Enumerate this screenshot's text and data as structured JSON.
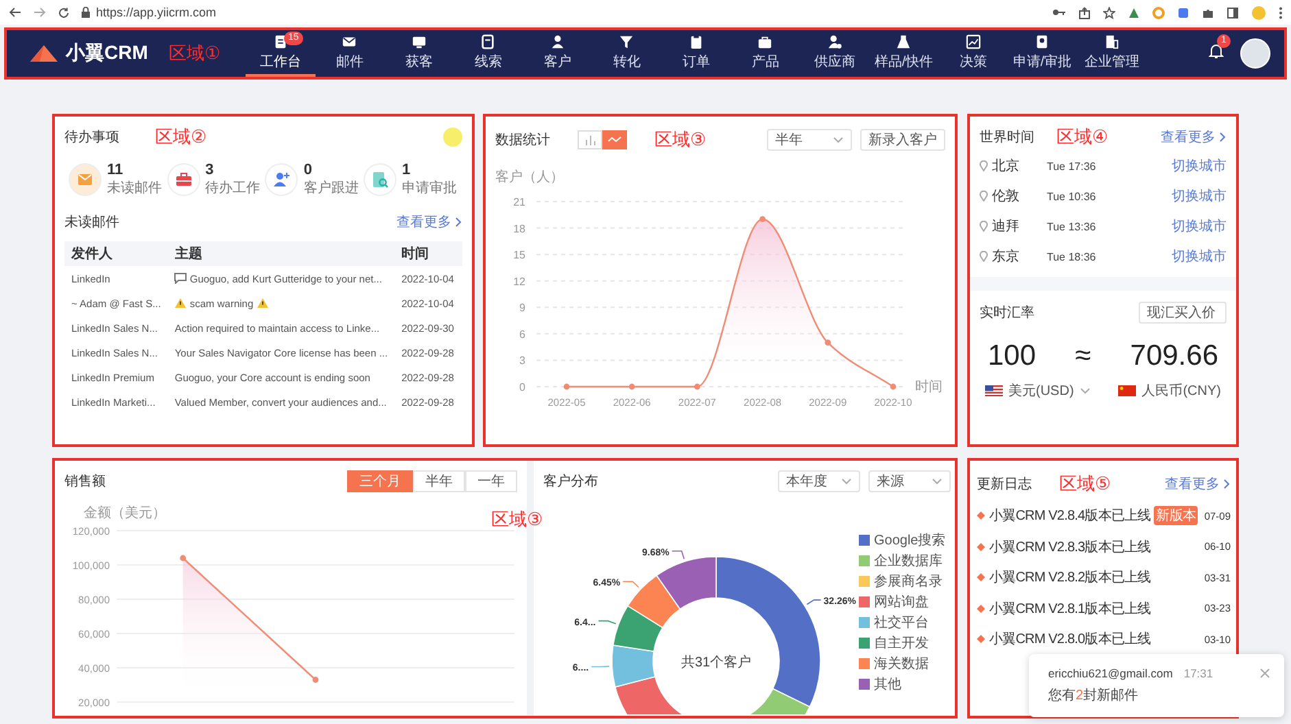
{
  "browser": {
    "url": "https://app.yiicrm.com"
  },
  "nav": {
    "logo": "小翼CRM",
    "region_label": "区域①",
    "notification_badge": "1",
    "items": [
      {
        "label": "工作台",
        "selected": true,
        "badge": "15"
      },
      {
        "label": "邮件",
        "selected": false
      },
      {
        "label": "获客",
        "selected": false
      },
      {
        "label": "线索",
        "selected": false
      },
      {
        "label": "客户",
        "selected": false
      },
      {
        "label": "转化",
        "selected": false
      },
      {
        "label": "订单",
        "selected": false
      },
      {
        "label": "产品",
        "selected": false
      },
      {
        "label": "供应商",
        "selected": false
      },
      {
        "label": "样品/快件",
        "selected": false
      },
      {
        "label": "决策",
        "selected": false
      },
      {
        "label": "申请/审批",
        "selected": false
      },
      {
        "label": "企业管理",
        "selected": false
      }
    ]
  },
  "todo": {
    "title": "待办事项",
    "region_label": "区域②",
    "stats": [
      {
        "kind": "mail",
        "value": "11",
        "label": "未读邮件"
      },
      {
        "kind": "task",
        "value": "3",
        "label": "待办工作"
      },
      {
        "kind": "follow_up",
        "value": "0",
        "label": "客户跟进"
      },
      {
        "kind": "approval",
        "value": "1",
        "label": "申请审批"
      }
    ],
    "mail_title": "未读邮件",
    "more": "查看更多",
    "columns": [
      "发件人",
      "主题",
      "时间"
    ],
    "rows": [
      {
        "kind": "message",
        "sender": "LinkedIn",
        "subject": "Guoguo, add Kurt Gutteridge to your net...",
        "date": "2022-10-04"
      },
      {
        "kind": "warning",
        "sender": "~ Adam @ Fast S...",
        "subject": "scam warning",
        "date": "2022-10-04"
      },
      {
        "kind": "plain",
        "sender": "LinkedIn Sales N...",
        "subject": "Action required to maintain access to Linke...",
        "date": "2022-09-30"
      },
      {
        "kind": "plain",
        "sender": "LinkedIn Sales N...",
        "subject": "Your Sales Navigator Core license has been ...",
        "date": "2022-09-28"
      },
      {
        "kind": "plain",
        "sender": "LinkedIn Premium",
        "subject": "Guoguo, your Core account is ending soon",
        "date": "2022-09-28"
      },
      {
        "kind": "plain",
        "sender": "LinkedIn Marketi...",
        "subject": "Valued Member, convert your audiences and...",
        "date": "2022-09-28"
      }
    ]
  },
  "stats": {
    "title": "数据统计",
    "region_label": "区域③",
    "chart_toggle": [
      {
        "kind": "bar",
        "selected": false
      },
      {
        "kind": "line",
        "selected": true
      }
    ],
    "period": "半年",
    "metric": "新录入客户",
    "chart_data": {
      "type": "area",
      "ylabel": "客户（人）",
      "xlabel": "时间",
      "categories": [
        "2022-05",
        "2022-06",
        "2022-07",
        "2022-08",
        "2022-09",
        "2022-10"
      ],
      "series": [
        {
          "color": "#f08c74",
          "values": [
            0,
            0,
            0,
            19,
            5,
            0
          ]
        }
      ],
      "ylim": [
        0,
        21
      ],
      "yticks": [
        0,
        3,
        6,
        9,
        12,
        15,
        18,
        21
      ],
      "grid": true
    }
  },
  "world_time": {
    "title": "世界时间",
    "region_label": "区域④",
    "more": "查看更多",
    "cities": [
      {
        "city": "北京",
        "time": "Tue 17:36",
        "action": "切换城市"
      },
      {
        "city": "伦敦",
        "time": "Tue 10:36",
        "action": "切换城市"
      },
      {
        "city": "迪拜",
        "time": "Tue 13:36",
        "action": "切换城市"
      },
      {
        "city": "东京",
        "time": "Tue 18:36",
        "action": "切换城市"
      }
    ]
  },
  "exchange": {
    "title": "实时汇率",
    "rate_type": "现汇买入价",
    "amount": "100",
    "approx": "≈",
    "result": "709.66",
    "from": "美元(USD)",
    "to": "人民币(CNY)"
  },
  "sales": {
    "title": "销售额",
    "ranges": [
      {
        "label": "三个月",
        "selected": true
      },
      {
        "label": "半年",
        "selected": false
      },
      {
        "label": "一年",
        "selected": false
      }
    ],
    "chart_data": {
      "type": "area",
      "ylabel": "金额（美元）",
      "categories": [
        null,
        null,
        null
      ],
      "series": [
        {
          "color": "#f08c74",
          "values": [
            104000,
            33000,
            null
          ]
        }
      ],
      "ylim": [
        20000,
        120000
      ],
      "grid": true,
      "yticks": [
        {
          "value": 20000,
          "label": "20,000"
        },
        {
          "value": 40000,
          "label": "40,000"
        },
        {
          "value": 60000,
          "label": "60,000"
        },
        {
          "value": 80000,
          "label": "80,000"
        },
        {
          "value": 100000,
          "label": "100,000"
        },
        {
          "value": 120000,
          "label": "120,000"
        }
      ]
    }
  },
  "bottom_region_label": "区域③",
  "customers": {
    "title": "客户分布",
    "period": "本年度",
    "group_by": "来源",
    "center_text": "共31个客户",
    "chart_data": {
      "type": "donut",
      "categories": [
        "Google搜索",
        "企业数据库",
        "参展商名录",
        "网站询盘",
        "社交平台",
        "自主开发",
        "海关数据",
        "其他"
      ],
      "colors": [
        "#5470c6",
        "#91cc75",
        "#fac858",
        "#ee6666",
        "#73c0de",
        "#3ba272",
        "#fc8452",
        "#9a60b4"
      ],
      "values": [
        32.26,
        9.68,
        0,
        29.03,
        6.45,
        6.45,
        6.45,
        9.68
      ],
      "value_labels": [
        "32.26%",
        null,
        null,
        null,
        "6....",
        "6.4...",
        "6.45%",
        "9.68%"
      ]
    }
  },
  "update_log": {
    "title": "更新日志",
    "region_label": "区域⑤",
    "more": "查看更多",
    "items": [
      {
        "text": "小翼CRM V2.8.4版本已上线",
        "date": "07-09",
        "badge": "新版本"
      },
      {
        "text": "小翼CRM V2.8.3版本已上线",
        "date": "06-10"
      },
      {
        "text": "小翼CRM V2.8.2版本已上线",
        "date": "03-31"
      },
      {
        "text": "小翼CRM V2.8.1版本已上线",
        "date": "03-23"
      },
      {
        "text": "小翼CRM V2.8.0版本已上线",
        "date": "03-10"
      }
    ]
  },
  "toast": {
    "email": "ericchiu621@gmail.com",
    "time": "17:31",
    "message_before": "您有",
    "count": "2",
    "message_after": "封新邮件"
  }
}
